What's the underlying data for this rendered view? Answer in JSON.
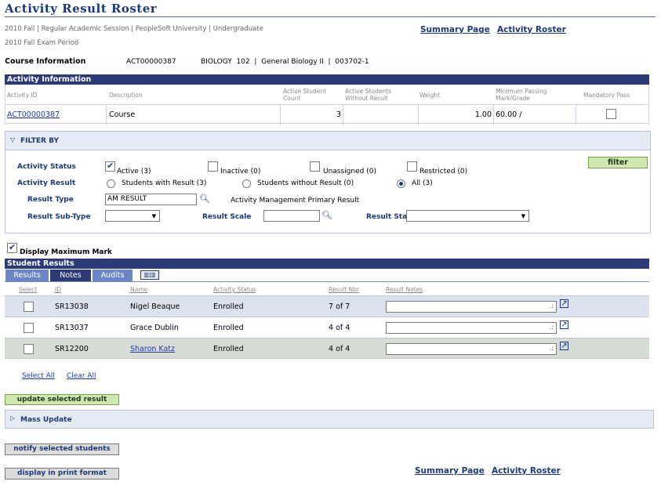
{
  "page": {
    "title": "Activity Result Roster",
    "context_line1": "2010 Fall | Regular Academic Session | PeopleSoft University | Undergraduate",
    "context_line2": "2010 Fall Exam Period",
    "summary_link": "Summary Page",
    "roster_link": "Activity Roster"
  },
  "course": {
    "label": "Course Information",
    "id": "ACT00000387",
    "detail": "BIOLOGY  102  |  General Biology II  |  003702-1"
  },
  "activity": {
    "header": "Activity Information",
    "columns": [
      "Activity ID",
      "Description",
      "Active Student Count",
      "Active Students Without Result",
      "Weight",
      "Minimum Passing Mark/Grade",
      "Mandatory Pass"
    ],
    "row": {
      "id": "ACT00000387",
      "description": "Course",
      "count": "3",
      "without_result": "",
      "weight": "1.00",
      "min_pass": "60.00 /",
      "mandatory": false
    }
  },
  "filter": {
    "header": "FILTER BY",
    "status_label": "Activity Status",
    "status_options": [
      {
        "label": "Active (3)",
        "checked": true
      },
      {
        "label": "Inactive (0)",
        "checked": false
      },
      {
        "label": "Unassigned (0)",
        "checked": false
      },
      {
        "label": "Restricted (0)",
        "checked": false
      }
    ],
    "result_label": "Activity Result",
    "result_options": [
      {
        "label": "Students with Result (3)",
        "selected": false
      },
      {
        "label": "Students without Result (0)",
        "selected": false
      },
      {
        "label": "All (3)",
        "selected": true
      }
    ],
    "result_type_label": "Result Type",
    "result_type_value": "AM RESULT",
    "result_type_desc": "Activity Management Primary Result",
    "subtype_label": "Result Sub-Type",
    "scale_label": "Result Scale",
    "status2_label": "Result Status",
    "filter_button": "filter"
  },
  "display_max": {
    "label": "Display Maximum Mark",
    "checked": true
  },
  "results": {
    "header": "Student Results",
    "tabs": [
      "Results",
      "Notes",
      "Audits"
    ],
    "columns": [
      "Select",
      "ID",
      "Name",
      "Activity Status",
      "Result Nbr",
      "Result Notes"
    ],
    "rows": [
      {
        "id": "SR13038",
        "name": "Nigel Beaque",
        "status": "Enrolled",
        "nbr": "7 of 7",
        "link": false
      },
      {
        "id": "SR13037",
        "name": "Grace Dublin",
        "status": "Enrolled",
        "nbr": "4 of 4",
        "link": false
      },
      {
        "id": "SR12200",
        "name": "Sharon Katz",
        "status": "Enrolled",
        "nbr": "4 of 4",
        "link": true
      }
    ],
    "select_all": "Select All",
    "clear_all": "Clear All"
  },
  "actions": {
    "update": "update selected result",
    "mass_update": "Mass Update",
    "notify": "notify selected students",
    "print": "display in print format"
  },
  "colors": {
    "header_bar": "#2c3a78",
    "link": "#1b3aa8",
    "button_green": "#cfe7b0"
  }
}
